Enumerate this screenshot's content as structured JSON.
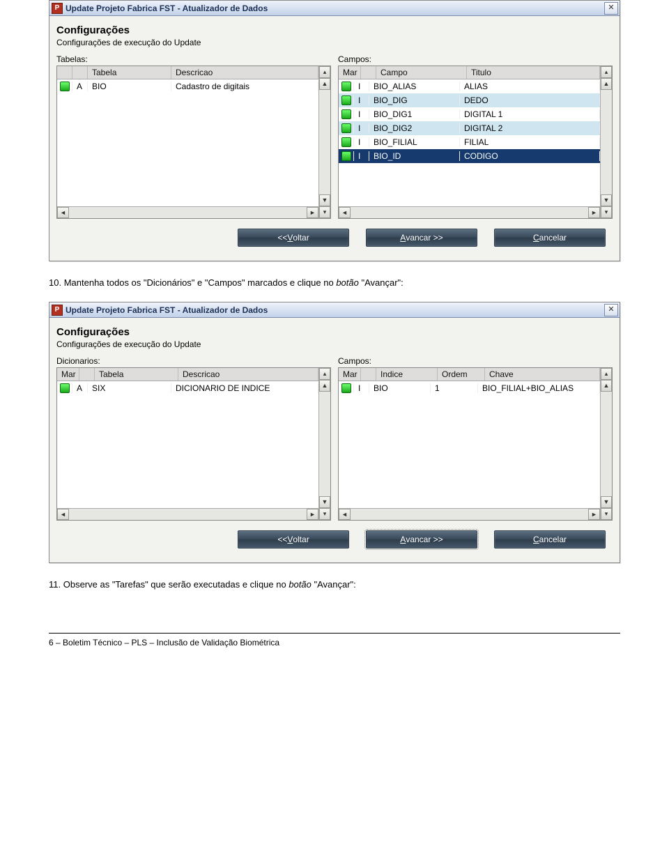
{
  "dialog1": {
    "title": "Update Projeto Fabrica FST - Atualizador de Dados",
    "heading": "Configurações",
    "subheading": "Configurações de execução do Update",
    "left": {
      "label": "Tabelas:",
      "cols": [
        "",
        "",
        "Tabela",
        "Descricao"
      ],
      "rows": [
        {
          "letter": "A",
          "tabela": "BIO",
          "desc": "Cadastro de digitais"
        }
      ]
    },
    "right": {
      "label": "Campos:",
      "cols": [
        "Mar",
        "",
        "Campo",
        "Titulo"
      ],
      "rows": [
        {
          "letter": "I",
          "campo": "BIO_ALIAS",
          "titulo": "ALIAS",
          "cls": ""
        },
        {
          "letter": "I",
          "campo": "BIO_DIG",
          "titulo": "DEDO",
          "cls": "row-alt"
        },
        {
          "letter": "I",
          "campo": "BIO_DIG1",
          "titulo": "DIGITAL 1",
          "cls": ""
        },
        {
          "letter": "I",
          "campo": "BIO_DIG2",
          "titulo": "DIGITAL 2",
          "cls": "row-alt"
        },
        {
          "letter": "I",
          "campo": "BIO_FILIAL",
          "titulo": "FILIAL",
          "cls": ""
        },
        {
          "letter": "I",
          "campo": "BIO_ID",
          "titulo": "CODIGO",
          "cls": "row-sel"
        }
      ]
    },
    "buttons": {
      "back_pre": "<< ",
      "back_u": "V",
      "back_post": "oltar",
      "next_u": "A",
      "next_post": "vancar >>",
      "cancel_u": "C",
      "cancel_post": "ancelar"
    }
  },
  "step10": {
    "num": "10.",
    "text_a": "Mantenha todos os \"Dicionários\" e \"Campos\" marcados e clique no ",
    "it": "botão",
    "text_b": " \"Avançar\":"
  },
  "dialog2": {
    "title": "Update Projeto Fabrica FST - Atualizador de Dados",
    "heading": "Configurações",
    "subheading": "Configurações de execução do Update",
    "left": {
      "label": "Dicionarios:",
      "cols": [
        "Mar",
        "",
        "Tabela",
        "Descricao"
      ],
      "rows": [
        {
          "letter": "A",
          "tabela": "SIX",
          "desc": "DICIONARIO DE INDICE"
        }
      ]
    },
    "right": {
      "label": "Campos:",
      "cols": [
        "Mar",
        "",
        "Indice",
        "Ordem",
        "Chave"
      ],
      "rows": [
        {
          "letter": "I",
          "indice": "BIO",
          "ordem": "1",
          "chave": "BIO_FILIAL+BIO_ALIAS"
        }
      ]
    },
    "buttons": {
      "back_pre": "<< ",
      "back_u": "V",
      "back_post": "oltar",
      "next_u": "A",
      "next_post": "vancar >>",
      "cancel_u": "C",
      "cancel_post": "ancelar"
    }
  },
  "step11": {
    "num": "11.",
    "text_a": "Observe as \"Tarefas\" que serão executadas e clique no ",
    "it": "botão",
    "text_b": " \"Avançar\":"
  },
  "footer": "6 – Boletim Técnico – PLS – Inclusão de Validação Biométrica"
}
